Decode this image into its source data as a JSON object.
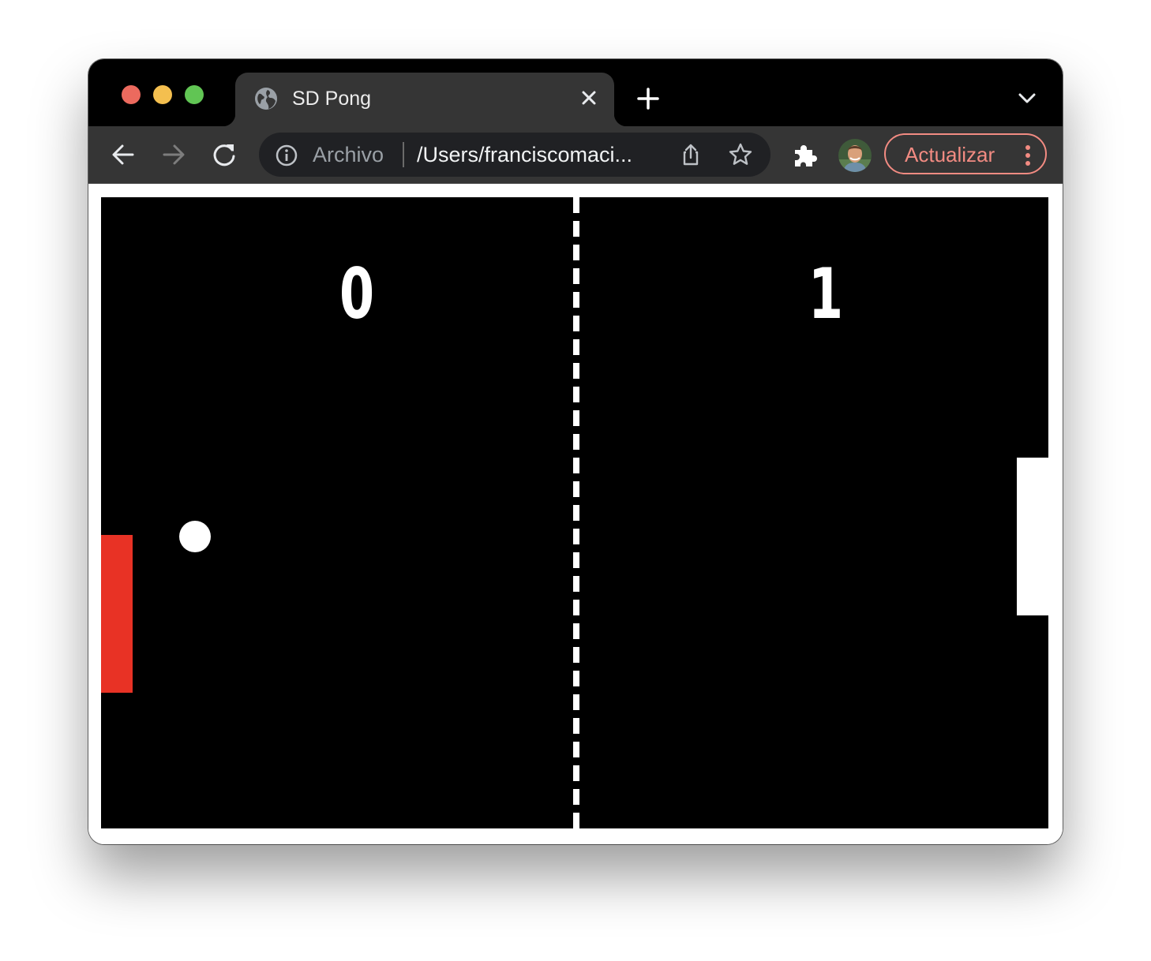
{
  "window": {
    "controls": {
      "close_color": "#ec6a5e",
      "minimize_color": "#f4bf4f",
      "zoom_color": "#61c554"
    }
  },
  "tab": {
    "title": "SD Pong",
    "favicon": "globe-icon",
    "close_icon": "close-icon"
  },
  "new_tab_icon": "plus-icon",
  "tab_menu_icon": "chevron-down-icon",
  "toolbar": {
    "back_icon": "arrow-left-icon",
    "forward_icon": "arrow-right-icon",
    "reload_icon": "reload-icon",
    "omnibox": {
      "info_icon": "info-icon",
      "scheme_label": "Archivo",
      "url": "/Users/franciscomaci...",
      "share_icon": "share-icon",
      "bookmark_icon": "star-icon"
    },
    "extensions_icon": "puzzle-icon",
    "profile_avatar": "avatar",
    "update_button": {
      "label": "Actualizar",
      "color": "#f28b82",
      "menu_icon": "kebab-menu-icon"
    }
  },
  "game": {
    "background": "#000000",
    "score_left": "0",
    "score_right": "1",
    "left_paddle_color": "#e83225",
    "right_paddle_color": "#ffffff",
    "ball_color": "#ffffff"
  }
}
